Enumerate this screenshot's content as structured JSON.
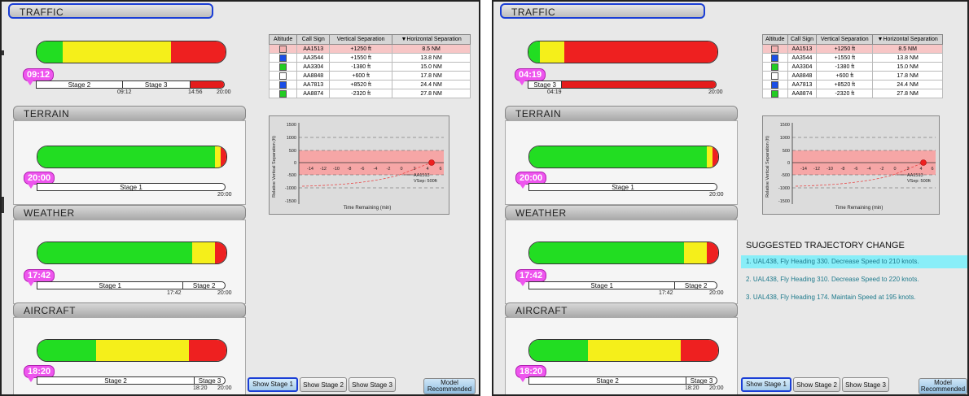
{
  "sections": {
    "traffic": "TRAFFIC",
    "terrain": "TERRAIN",
    "weather": "WEATHER",
    "aircraft": "AIRCRAFT"
  },
  "colors": {
    "green": "#22dd22",
    "yellow": "#f5ef1a",
    "red": "#ee2020",
    "badge": "#ee55ee",
    "highlight": "#88eef8",
    "selection": "#1a3ed6"
  },
  "table": {
    "headers": [
      "Altitude",
      "Call Sign",
      "Vertical Separation",
      "▼Horizontal Separation"
    ],
    "rows": [
      {
        "color": "#f4b0b0",
        "call": "AA1513",
        "vsep": "+1250 ft",
        "hsep": "8.5 NM"
      },
      {
        "color": "#1a4ee6",
        "call": "AA3544",
        "vsep": "+1550 ft",
        "hsep": "13.8 NM"
      },
      {
        "color": "#22cc22",
        "call": "AA3304",
        "vsep": "-1380 ft",
        "hsep": "15.0 NM"
      },
      {
        "color": "#ffffff",
        "call": "AA8848",
        "vsep": "+600 ft",
        "hsep": "17.8 NM"
      },
      {
        "color": "#1a4ee6",
        "call": "AA7813",
        "vsep": "+8520 ft",
        "hsep": "24.4 NM"
      },
      {
        "color": "#22cc22",
        "call": "AA8874",
        "vsep": "-2320 ft",
        "hsep": "27.8 NM"
      }
    ]
  },
  "graph": {
    "ylabel": "Relative Vertical Separation (ft)",
    "xlabel": "Time Remaining (min)",
    "yticks": [
      "1500",
      "1000",
      "500",
      "0",
      "-500",
      "-1000",
      "-1500"
    ],
    "xticks": [
      "-14",
      "-12",
      "-10",
      "-8",
      "-6",
      "-4",
      "-2",
      "0",
      "2",
      "4",
      "6"
    ],
    "annot_call": "AA1513",
    "annot_vsep": "VSep: 500ft"
  },
  "buttons": {
    "stage1": "Show Stage 1",
    "stage2": "Show Stage 2",
    "stage3": "Show Stage 3",
    "model_l1": "Model",
    "model_l2": "Recommended"
  },
  "left": {
    "traffic": {
      "time": "09:12",
      "stage_a": "Stage 2",
      "stage_b": "Stage 3",
      "t1": "09:12",
      "t2": "14:56",
      "t3": "20:00"
    },
    "terrain": {
      "time": "20:00",
      "stage_a": "Stage 1",
      "t3": "20:00"
    },
    "weather": {
      "time": "17:42",
      "stage_a": "Stage 1",
      "stage_b": "Stage 2",
      "t2": "17:42",
      "t3": "20:00"
    },
    "aircraft": {
      "time": "18:20",
      "stage_a": "Stage 2",
      "stage_b": "Stage 3",
      "t2": "18:20",
      "t3": "20:00"
    }
  },
  "right": {
    "traffic": {
      "time": "04:19",
      "stage_a": "Stage 3",
      "t1": "04:19",
      "t3": "20:00"
    },
    "terrain": {
      "time": "20:00",
      "stage_a": "Stage 1",
      "t3": "20:00"
    },
    "weather": {
      "time": "17:42",
      "stage_a": "Stage 1",
      "stage_b": "Stage 2",
      "t2": "17:42",
      "t3": "20:00"
    },
    "aircraft": {
      "time": "18:20",
      "stage_a": "Stage 2",
      "stage_b": "Stage 3",
      "t2": "18:20",
      "t3": "20:00"
    }
  },
  "suggestions": {
    "title": "SUGGESTED TRAJECTORY CHANGE",
    "items": [
      "1. UAL438, Fly Heading 330. Decrease Speed to 210 knots.",
      "2. UAL438, Fly Heading 310. Decrease Speed to 220 knots.",
      "3. UAL438, Fly Heading 174. Maintain Speed at 195 knots."
    ]
  }
}
